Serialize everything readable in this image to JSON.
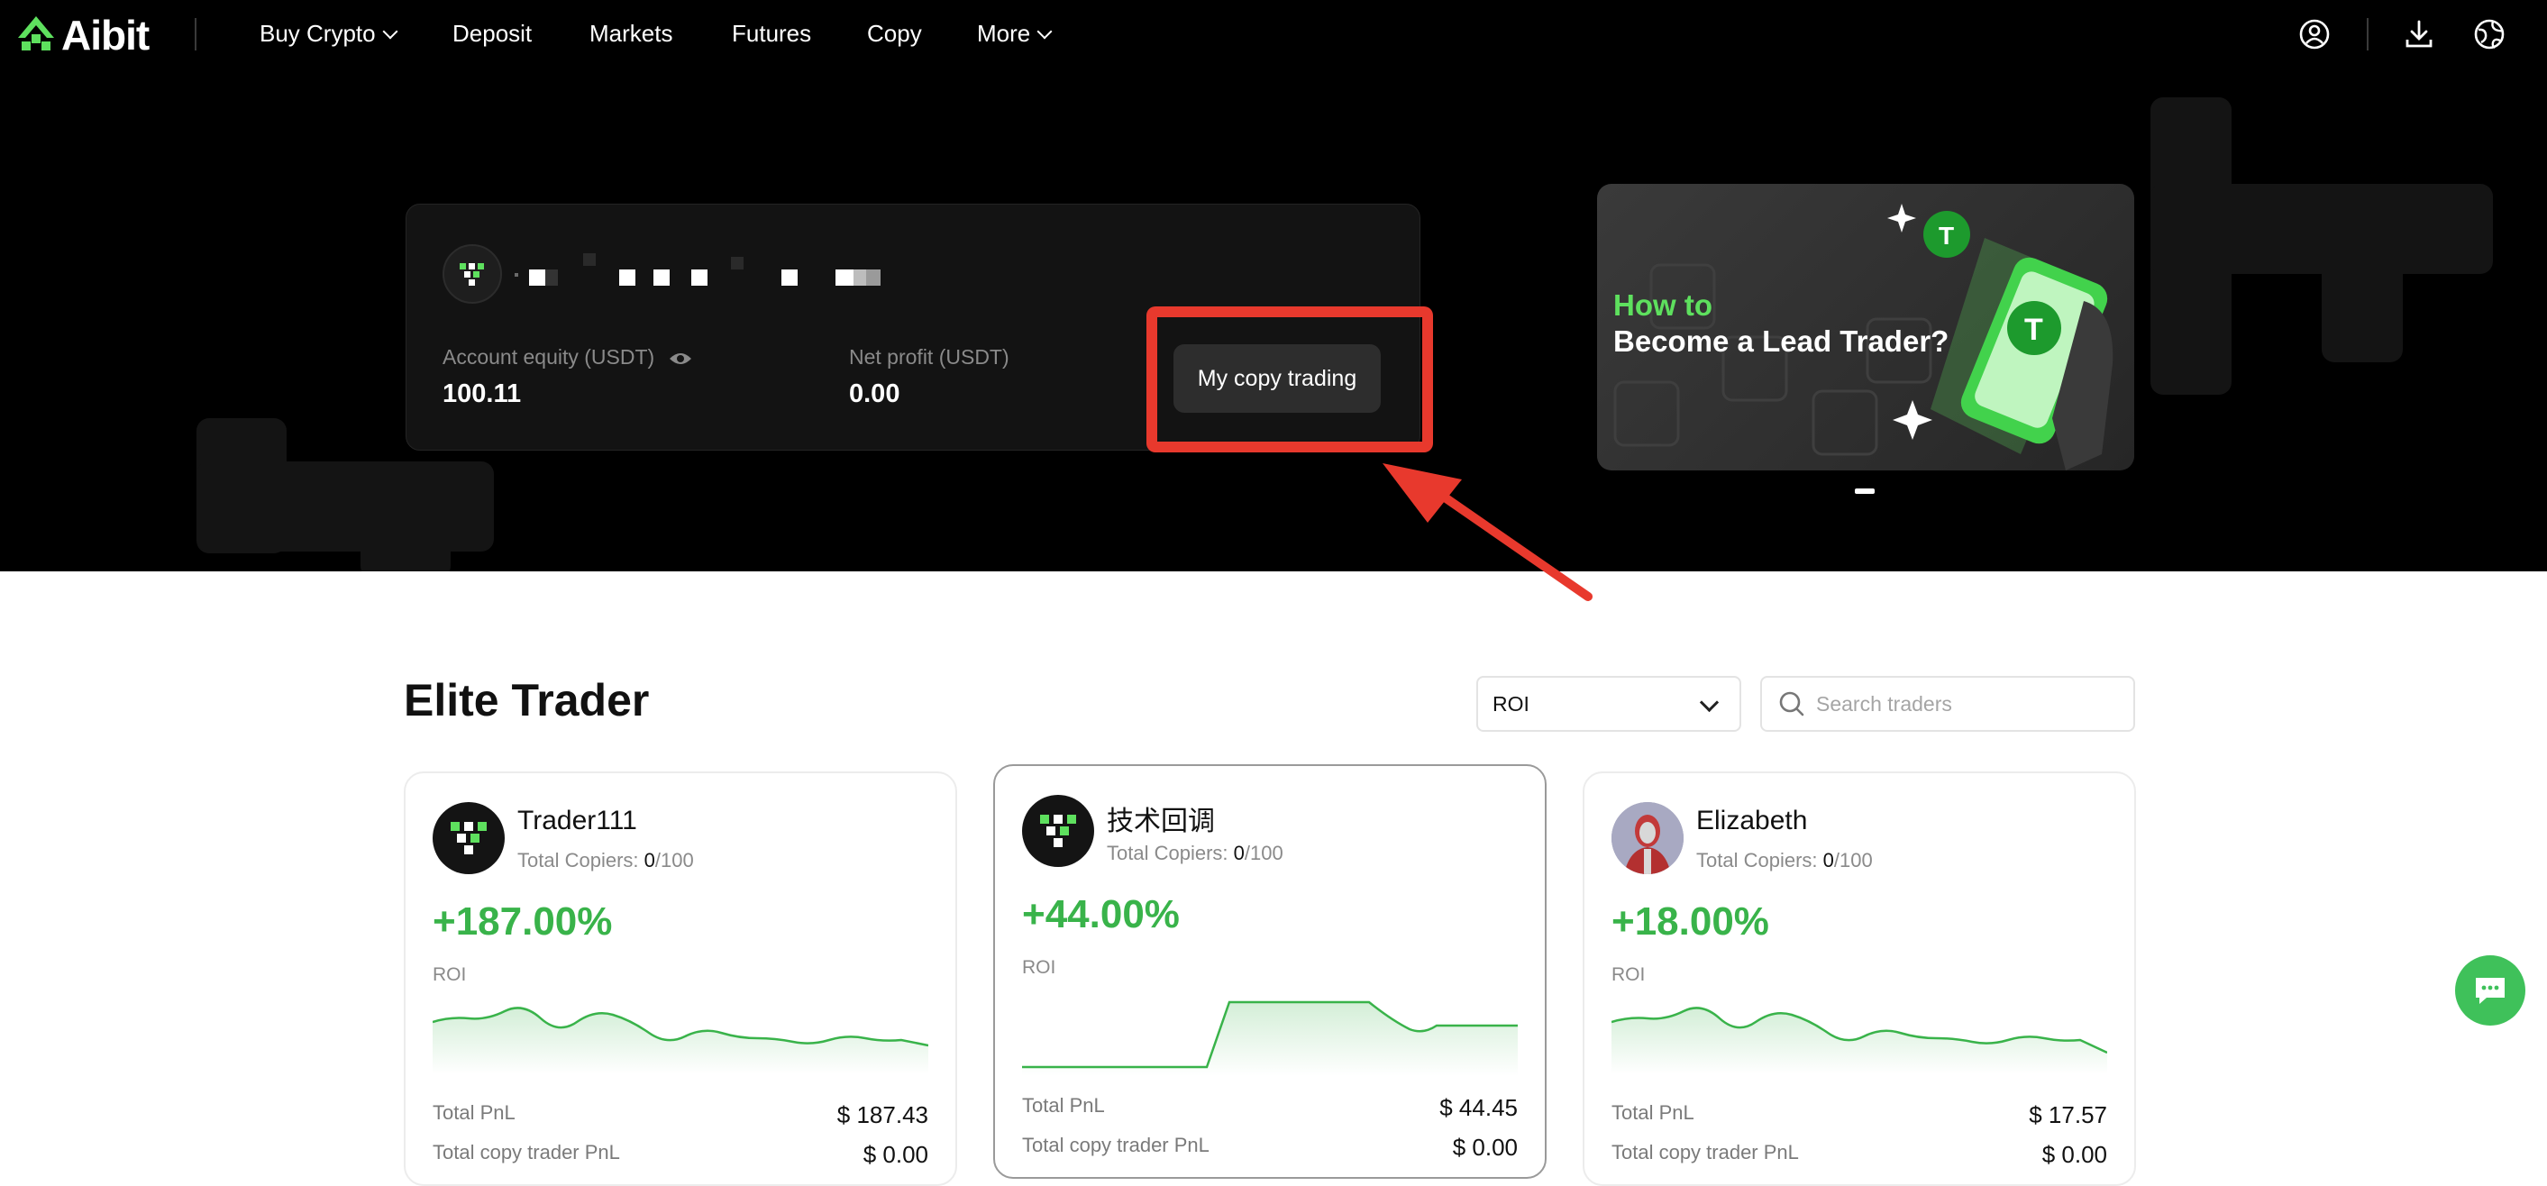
{
  "nav": {
    "logo_text": "Aibit",
    "items": [
      {
        "label": "Buy Crypto"
      },
      {
        "label": "Deposit"
      },
      {
        "label": "Markets"
      },
      {
        "label": "Futures"
      },
      {
        "label": "Copy"
      },
      {
        "label": "More"
      }
    ],
    "icons": [
      "user-icon",
      "download-icon",
      "globe-icon"
    ]
  },
  "account": {
    "equity_label": "Account equity (USDT)",
    "equity_value": "100.11",
    "profit_label": "Net profit (USDT)",
    "profit_value": "0.00",
    "my_copy_button": "My copy trading"
  },
  "banner": {
    "line1": "How to",
    "line2": "Become a Lead Trader?"
  },
  "elite": {
    "title": "Elite Trader",
    "sort_value": "ROI",
    "search_placeholder": "Search traders",
    "traders": [
      {
        "name": "Trader111",
        "copiers_label": "Total Copiers:",
        "copiers": "0",
        "copiers_max": "/100",
        "roi": "+187.00%",
        "roi_label": "ROI",
        "pnl_label": "Total PnL",
        "pnl": "$ 187.43",
        "copy_pnl_label": "Total copy trader PnL",
        "copy_pnl": "$ 0.00"
      },
      {
        "name": "技术回调",
        "copiers_label": "Total Copiers:",
        "copiers": "0",
        "copiers_max": "/100",
        "roi": "+44.00%",
        "roi_label": "ROI",
        "pnl_label": "Total PnL",
        "pnl": "$ 44.45",
        "copy_pnl_label": "Total copy trader PnL",
        "copy_pnl": "$ 0.00"
      },
      {
        "name": "Elizabeth",
        "copiers_label": "Total Copiers:",
        "copiers": "0",
        "copiers_max": "/100",
        "roi": "+18.00%",
        "roi_label": "ROI",
        "pnl_label": "Total PnL",
        "pnl": "$ 17.57",
        "copy_pnl_label": "Total copy trader PnL",
        "copy_pnl": "$ 0.00"
      }
    ]
  },
  "colors": {
    "accent": "#39b34a",
    "highlight": "#e8392d"
  }
}
